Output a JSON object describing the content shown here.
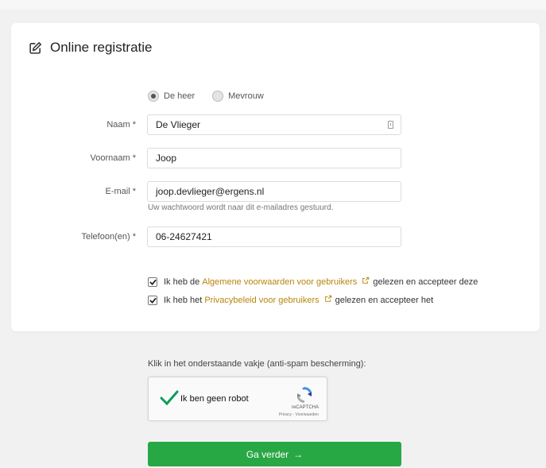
{
  "form": {
    "title": "Online registratie",
    "salutation": {
      "options": [
        {
          "label": "De heer",
          "selected": true
        },
        {
          "label": "Mevrouw",
          "selected": false
        }
      ]
    },
    "fields": {
      "naam": {
        "label": "Naam *",
        "value": "De Vlieger"
      },
      "voornaam": {
        "label": "Voornaam *",
        "value": "Joop"
      },
      "email": {
        "label": "E-mail *",
        "value": "joop.devlieger@ergens.nl",
        "helper": "Uw wachtwoord wordt naar dit e-mailadres gestuurd."
      },
      "telefoon": {
        "label": "Telefoon(en) *",
        "value": "06-24627421"
      }
    },
    "agreements": [
      {
        "prefix": "Ik heb de",
        "link": "Algemene voorwaarden voor gebruikers",
        "suffix": "gelezen en accepteer deze",
        "checked": true
      },
      {
        "prefix": "Ik heb het",
        "link": "Privacybeleid voor gebruikers",
        "suffix": "gelezen en accepteer het",
        "checked": true
      }
    ]
  },
  "captcha": {
    "instruction": "Klik in het onderstaande vakje (anti-spam bescherming):",
    "label": "Ik ben geen robot",
    "brand": "reCAPTCHA",
    "links": "Privacy - Voorwaarden"
  },
  "submit": {
    "label": "Ga verder",
    "arrow": "→"
  },
  "colors": {
    "accent_green": "#28a745",
    "link": "#b8860b",
    "check_green": "#0f9d58"
  }
}
